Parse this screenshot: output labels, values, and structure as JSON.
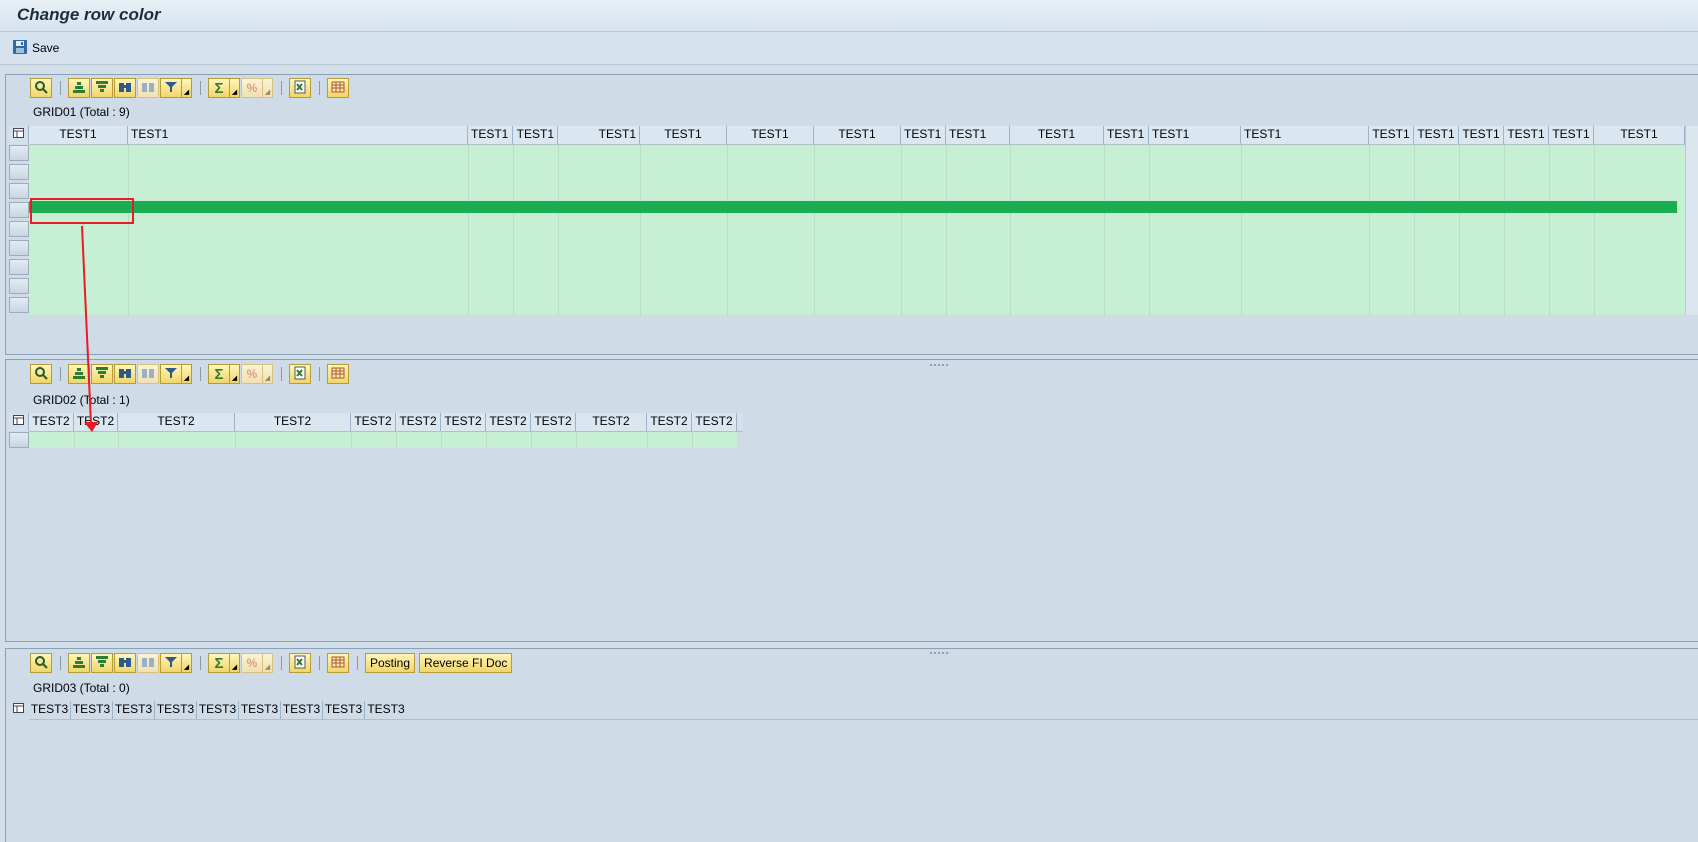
{
  "window": {
    "title": "Change row color"
  },
  "appbar": {
    "save_label": "Save"
  },
  "toolbar_icons": [
    "details-icon",
    "sort-ascending-icon",
    "sort-descending-icon",
    "find-icon",
    "find-next-icon",
    "filter-icon",
    "total-icon",
    "subtotal-icon",
    "export-icon",
    "layout-icon"
  ],
  "grid01": {
    "title": "GRID01 (Total : 9)",
    "columns": [
      "TEST1",
      "TEST1",
      "TEST1",
      "TEST1",
      "TEST1",
      "TEST1",
      "TEST1",
      "TEST1",
      "TEST1",
      "TEST1",
      "TEST1",
      "TEST1",
      "TEST1",
      "TEST1",
      "TEST1",
      "TEST1",
      "TEST1",
      "TEST1",
      "TEST1",
      "TEST1"
    ],
    "row_count": 9
  },
  "grid02": {
    "title": "GRID02 (Total : 1)",
    "columns": [
      "TEST2",
      "TEST2",
      "TEST2",
      "TEST2",
      "TEST2",
      "TEST2",
      "TEST2",
      "TEST2",
      "TEST2",
      "TEST2",
      "TEST2",
      "TEST2"
    ],
    "row_count": 1
  },
  "grid03": {
    "title": "GRID03 (Total : 0)",
    "columns": [
      "TEST3",
      "TEST3",
      "TEST3",
      "TEST3",
      "TEST3",
      "TEST3",
      "TEST3",
      "TEST3",
      "TEST3"
    ],
    "buttons": {
      "posting": "Posting",
      "reverse": "Reverse FI Doc"
    }
  },
  "colors": {
    "row_bg": "#c7efd3",
    "highlight_row": "#1cad52",
    "annotation": "#e81c24",
    "button_bg": "#f1d56a"
  }
}
